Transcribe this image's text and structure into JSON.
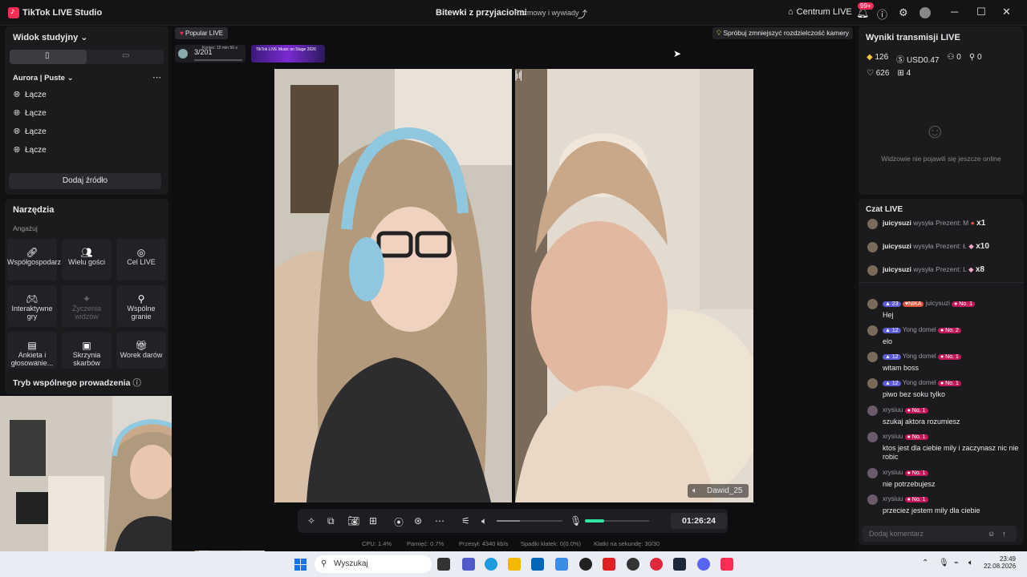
{
  "window": {
    "app_title": "TikTok LIVE Studio",
    "stream_title": "Bitewki z przyjaciolmi",
    "stream_category": "Rozmowy i wywiady",
    "centrum_label": "Centrum LIVE",
    "notif_badge": "99+"
  },
  "sidebar": {
    "studio_view": "Widok studyjny",
    "scene_name": "Aurora | Puste",
    "sources": [
      "Łącze",
      "Łącze",
      "Łącze",
      "Łącze"
    ],
    "add_source": "Dodaj źródło"
  },
  "tools": {
    "title": "Narzędzia",
    "section": "Angażuj",
    "items": [
      "Współgospodarz",
      "Wielu gości",
      "Cel LIVE",
      "Interaktywne gry",
      "Życzenia widzów",
      "Wspólne granie",
      "Ankieta i głosowanie...",
      "Skrzynia skarbów",
      "Worek darów"
    ],
    "co_host_mode": "Tryb wspólnego prowadzenia"
  },
  "stage": {
    "popular": "Popular LIVE",
    "rank": "3/201",
    "rank_time": "Koniec: 15 min 56 s",
    "event_banner": "TikTok LIVE Music on Stage 2026",
    "hint": "Spróbuj zmniejszyć rozdzielczość kamery",
    "guest_name": "Dawid_25",
    "timer": "01:26:24",
    "volume_level": 0.35,
    "mic_level": 0.3,
    "stats": {
      "cpu": "CPU: 1.4%",
      "memory": "Pamięć: 0.7%",
      "bitrate": "Przesył: 4340 kb/s",
      "dropped": "Spadki klatek: 0(0.0%)",
      "fps": "Klatki na sekundę: 30/30"
    }
  },
  "results": {
    "title": "Wyniki transmisji LIVE",
    "diamonds": "126",
    "usd": "USD0.47",
    "viewers": "0",
    "shares": "0",
    "likes": "626",
    "gifts": "4",
    "empty_msg": "Widzowie nie pojawili się jeszcze online"
  },
  "chat": {
    "title": "Czat LIVE",
    "gifts": [
      {
        "user": "juicysuzi",
        "text": "wysyła Prezent: M",
        "count": "x1"
      },
      {
        "user": "juicysuzi",
        "text": "wysyła Prezent: Ł",
        "count": "x10"
      },
      {
        "user": "juicysuzi",
        "text": "wysyła Prezent: L",
        "count": "x8"
      }
    ],
    "messages": [
      {
        "level": "23",
        "fan": "NIKA",
        "user": "juicysuzi",
        "rank": "No. 1",
        "text": "Hej"
      },
      {
        "level": "12",
        "user": "Yong domel",
        "rank": "No. 2",
        "text": "elo"
      },
      {
        "level": "12",
        "user": "Yong domel",
        "rank": "No. 1",
        "text": "witam boss"
      },
      {
        "level": "12",
        "user": "Yong domel",
        "rank": "No. 1",
        "text": "piwo bez soku tylko"
      },
      {
        "user": "xrysiuu",
        "rank": "No. 1",
        "text": "szukaj aktora rozumiesz"
      },
      {
        "user": "xrysiuu",
        "rank": "No. 1",
        "text": "ktos jest dla ciebie mily i zaczynasz nic nie robic"
      },
      {
        "user": "xrysiuu",
        "rank": "No. 1",
        "text": "nie potrzebujesz"
      },
      {
        "user": "xrysiuu",
        "rank": "No. 1",
        "text": "przeciez jestem mily dla ciebie"
      }
    ],
    "comment_placeholder": "Dodaj komentarz"
  },
  "taskbar": {
    "search": "Wyszukaj",
    "time": "23:49",
    "date": "22.08.2026"
  },
  "colors": {
    "accent": "#fe2c55",
    "green": "#2ee6a6",
    "level_blue": "#5b5bd6",
    "fan_orange": "#e0553a",
    "rank_pink": "#c2185b"
  }
}
